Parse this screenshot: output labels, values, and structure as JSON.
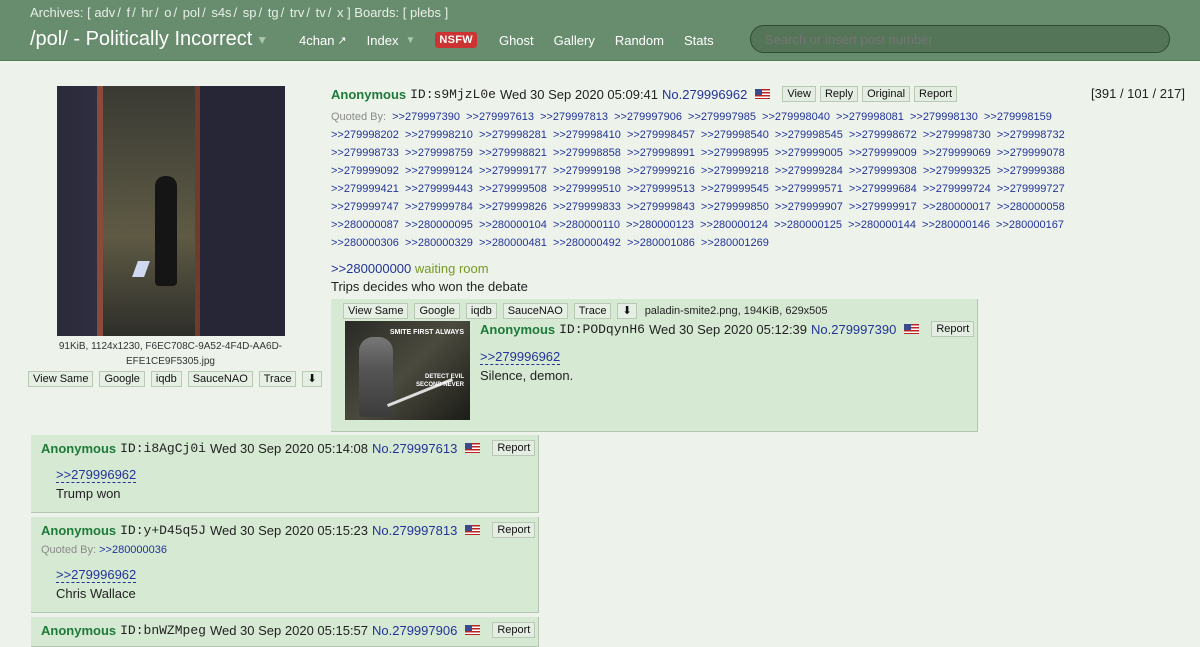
{
  "header": {
    "archives_label": "Archives:",
    "archives": [
      "adv",
      "f",
      "hr",
      "o",
      "pol",
      "s4s",
      "sp",
      "tg",
      "trv",
      "tv",
      "x"
    ],
    "boards_label": "Boards:",
    "boards": [
      "plebs"
    ],
    "board_title": "/pol/ - Politically Incorrect",
    "nav": {
      "fourchan": "4chan",
      "index": "Index",
      "nsfw": "NSFW",
      "ghost": "Ghost",
      "gallery": "Gallery",
      "random": "Random",
      "stats": "Stats"
    },
    "search_placeholder": "Search or insert post number"
  },
  "file_buttons": {
    "view_same": "View Same",
    "google": "Google",
    "iqdb": "iqdb",
    "saucenao": "SauceNAO",
    "trace": "Trace"
  },
  "op": {
    "file_meta": "91KiB, 1124x1230, F6EC708C-9A52-4F4D-AA6D-EFE1CE9F5305.jpg",
    "name": "Anonymous",
    "id": "ID:s9MjzL0e",
    "date": "Wed 30 Sep 2020 05:09:41",
    "number": "No.279996962",
    "buttons": {
      "view": "View",
      "reply": "Reply",
      "original": "Original",
      "report": "Report"
    },
    "counts": "[391 / 101 / 217]",
    "quoted_label": "Quoted By:",
    "quoted_by": [
      ">>279997390",
      ">>279997613",
      ">>279997813",
      ">>279997906",
      ">>279997985",
      ">>279998040",
      ">>279998081",
      ">>279998130",
      ">>279998159",
      ">>279998202",
      ">>279998210",
      ">>279998281",
      ">>279998410",
      ">>279998457",
      ">>279998540",
      ">>279998545",
      ">>279998672",
      ">>279998730",
      ">>279998732",
      ">>279998733",
      ">>279998759",
      ">>279998821",
      ">>279998858",
      ">>279998991",
      ">>279998995",
      ">>279999005",
      ">>279999009",
      ">>279999069",
      ">>279999078",
      ">>279999092",
      ">>279999124",
      ">>279999177",
      ">>279999198",
      ">>279999216",
      ">>279999218",
      ">>279999284",
      ">>279999308",
      ">>279999325",
      ">>279999388",
      ">>279999421",
      ">>279999443",
      ">>279999508",
      ">>279999510",
      ">>279999513",
      ">>279999545",
      ">>279999571",
      ">>279999684",
      ">>279999724",
      ">>279999727",
      ">>279999747",
      ">>279999784",
      ">>279999826",
      ">>279999833",
      ">>279999843",
      ">>279999850",
      ">>279999907",
      ">>279999917",
      ">>280000017",
      ">>280000058",
      ">>280000087",
      ">>280000095",
      ">>280000104",
      ">>280000110",
      ">>280000123",
      ">>280000124",
      ">>280000125",
      ">>280000144",
      ">>280000146",
      ">>280000167",
      ">>280000306",
      ">>280000329",
      ">>280000481",
      ">>280000492",
      ">>280001086",
      ">>280001269"
    ],
    "body_link": ">>280000000",
    "body_link_text": "waiting room",
    "body_text": "Trips decides who won the debate"
  },
  "inline_reply": {
    "file_name": "paladin-smite2.png, 194KiB, 629x505",
    "thumb_text_top": "SMITE FIRST ALWAYS",
    "thumb_text_bottom": "DETECT EVIL SECOND NEVER",
    "name": "Anonymous",
    "id": "ID:PODqynH6",
    "date": "Wed 30 Sep 2020 05:12:39",
    "number": "No.279997390",
    "report": "Report",
    "quote": ">>279996962",
    "text": "Silence, demon."
  },
  "replies": [
    {
      "name": "Anonymous",
      "id": "ID:i8AgCj0i",
      "date": "Wed 30 Sep 2020 05:14:08",
      "number": "No.279997613",
      "report": "Report",
      "quote": ">>279996962",
      "text": "Trump won"
    },
    {
      "name": "Anonymous",
      "id": "ID:y+D45q5J",
      "date": "Wed 30 Sep 2020 05:15:23",
      "number": "No.279997813",
      "report": "Report",
      "quoted_label": "Quoted By:",
      "quoted_by": ">>280000036",
      "quote": ">>279996962",
      "text": "Chris Wallace"
    },
    {
      "name": "Anonymous",
      "id": "ID:bnWZMpeg",
      "date": "Wed 30 Sep 2020 05:15:57",
      "number": "No.279997906",
      "report": "Report"
    }
  ]
}
